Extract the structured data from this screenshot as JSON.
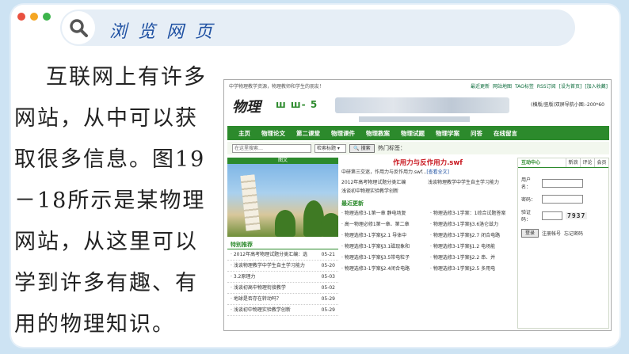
{
  "header": {
    "dot_colors": [
      "#e9503f",
      "#f5a623",
      "#3cb44b"
    ],
    "search_icon": "search-icon",
    "title": "浏览网页"
  },
  "body": {
    "paragraph": "互联网上有许多网站，从中可以获取很多信息。图19－18所示是某物理网站，从这里可以学到许多有趣、有用的物理知识。"
  },
  "website": {
    "top_left": "中学物理教学资源，物理教师和学生的朋友！",
    "top_links": [
      "最近更新",
      "网站地图",
      "TAG标签",
      "RSS订阅",
      "[设为首页]",
      "[加入收藏]"
    ],
    "logo_main": "物理",
    "logo_green": "ш ш- 5",
    "address": "(横版/竖版)双屏导航小图:-200*60",
    "nav": [
      "主页",
      "物理论文",
      "第二课堂",
      "物理课件",
      "物理教案",
      "物理试题",
      "物理学案",
      "问答",
      "在线留言"
    ],
    "search_placeholder": "在这里搜索…",
    "search_select": "检索标题 ▾",
    "search_button": "🔍 搜索",
    "hot_label": "热门标签：",
    "photo_label": "图文",
    "recommend_title": "特别推荐",
    "recommend_items": [
      {
        "text": "· 2012年高考物理试题分类汇编：选",
        "date": "05-21"
      },
      {
        "text": "· 浅谈物理教学中学生自主学习能力",
        "date": "05-20"
      },
      {
        "text": "· 3.2原理力",
        "date": "05-03"
      },
      {
        "text": "· 浅谈初高中物理衔接教学",
        "date": "05-02"
      },
      {
        "text": "· 地球是否存在转动吗？",
        "date": "05-29"
      },
      {
        "text": "· 浅谈初中物理实验教学创新",
        "date": "05-29"
      }
    ],
    "article_title": "作用力与反作用力.swf",
    "article_sub": "中研第三交迷，作用力与反作用力.swf...",
    "article_link": "[查看全文]",
    "article_pairs": [
      "2012年高考物理试题分类汇编",
      "浅谈物理教学中学生自主学习能力",
      "浅谈初中物理实验教学创新",
      ""
    ],
    "updates_title": "最近更新",
    "updates": [
      "· 物理选修3-1第一章 静电场复",
      "· 物理选修3-1学案：1综合试题答案",
      "· 高一物理必修1第一章、第二章",
      "· 物理选修3-1学案§3.6洛仑兹力",
      "· 物理选修3-1学案§2.1 导体中",
      "· 物理选修3-1学案§2.7 闭合电路",
      "· 物理选修3-1学案§3.1磁现象和",
      "· 物理选修3-1学案§1.2 电场能",
      "· 物理选修3-1学案§3.5带电粒子",
      "· 物理选修3-1学案§2.2 串、并",
      "· 物理选修3-1学案§2.4闭合电路",
      "· 物理选修3-1学案§2.5 多用电"
    ],
    "login_title": "互动中心",
    "login_tabs": [
      "新浪",
      "评论",
      "会员"
    ],
    "username_label": "用户名：",
    "password_label": "密码：",
    "captcha_label": "验证码：",
    "captcha_value": "7937",
    "login_button": "登录",
    "register_link": "注册帐号",
    "forgot_link": "忘记密码"
  }
}
